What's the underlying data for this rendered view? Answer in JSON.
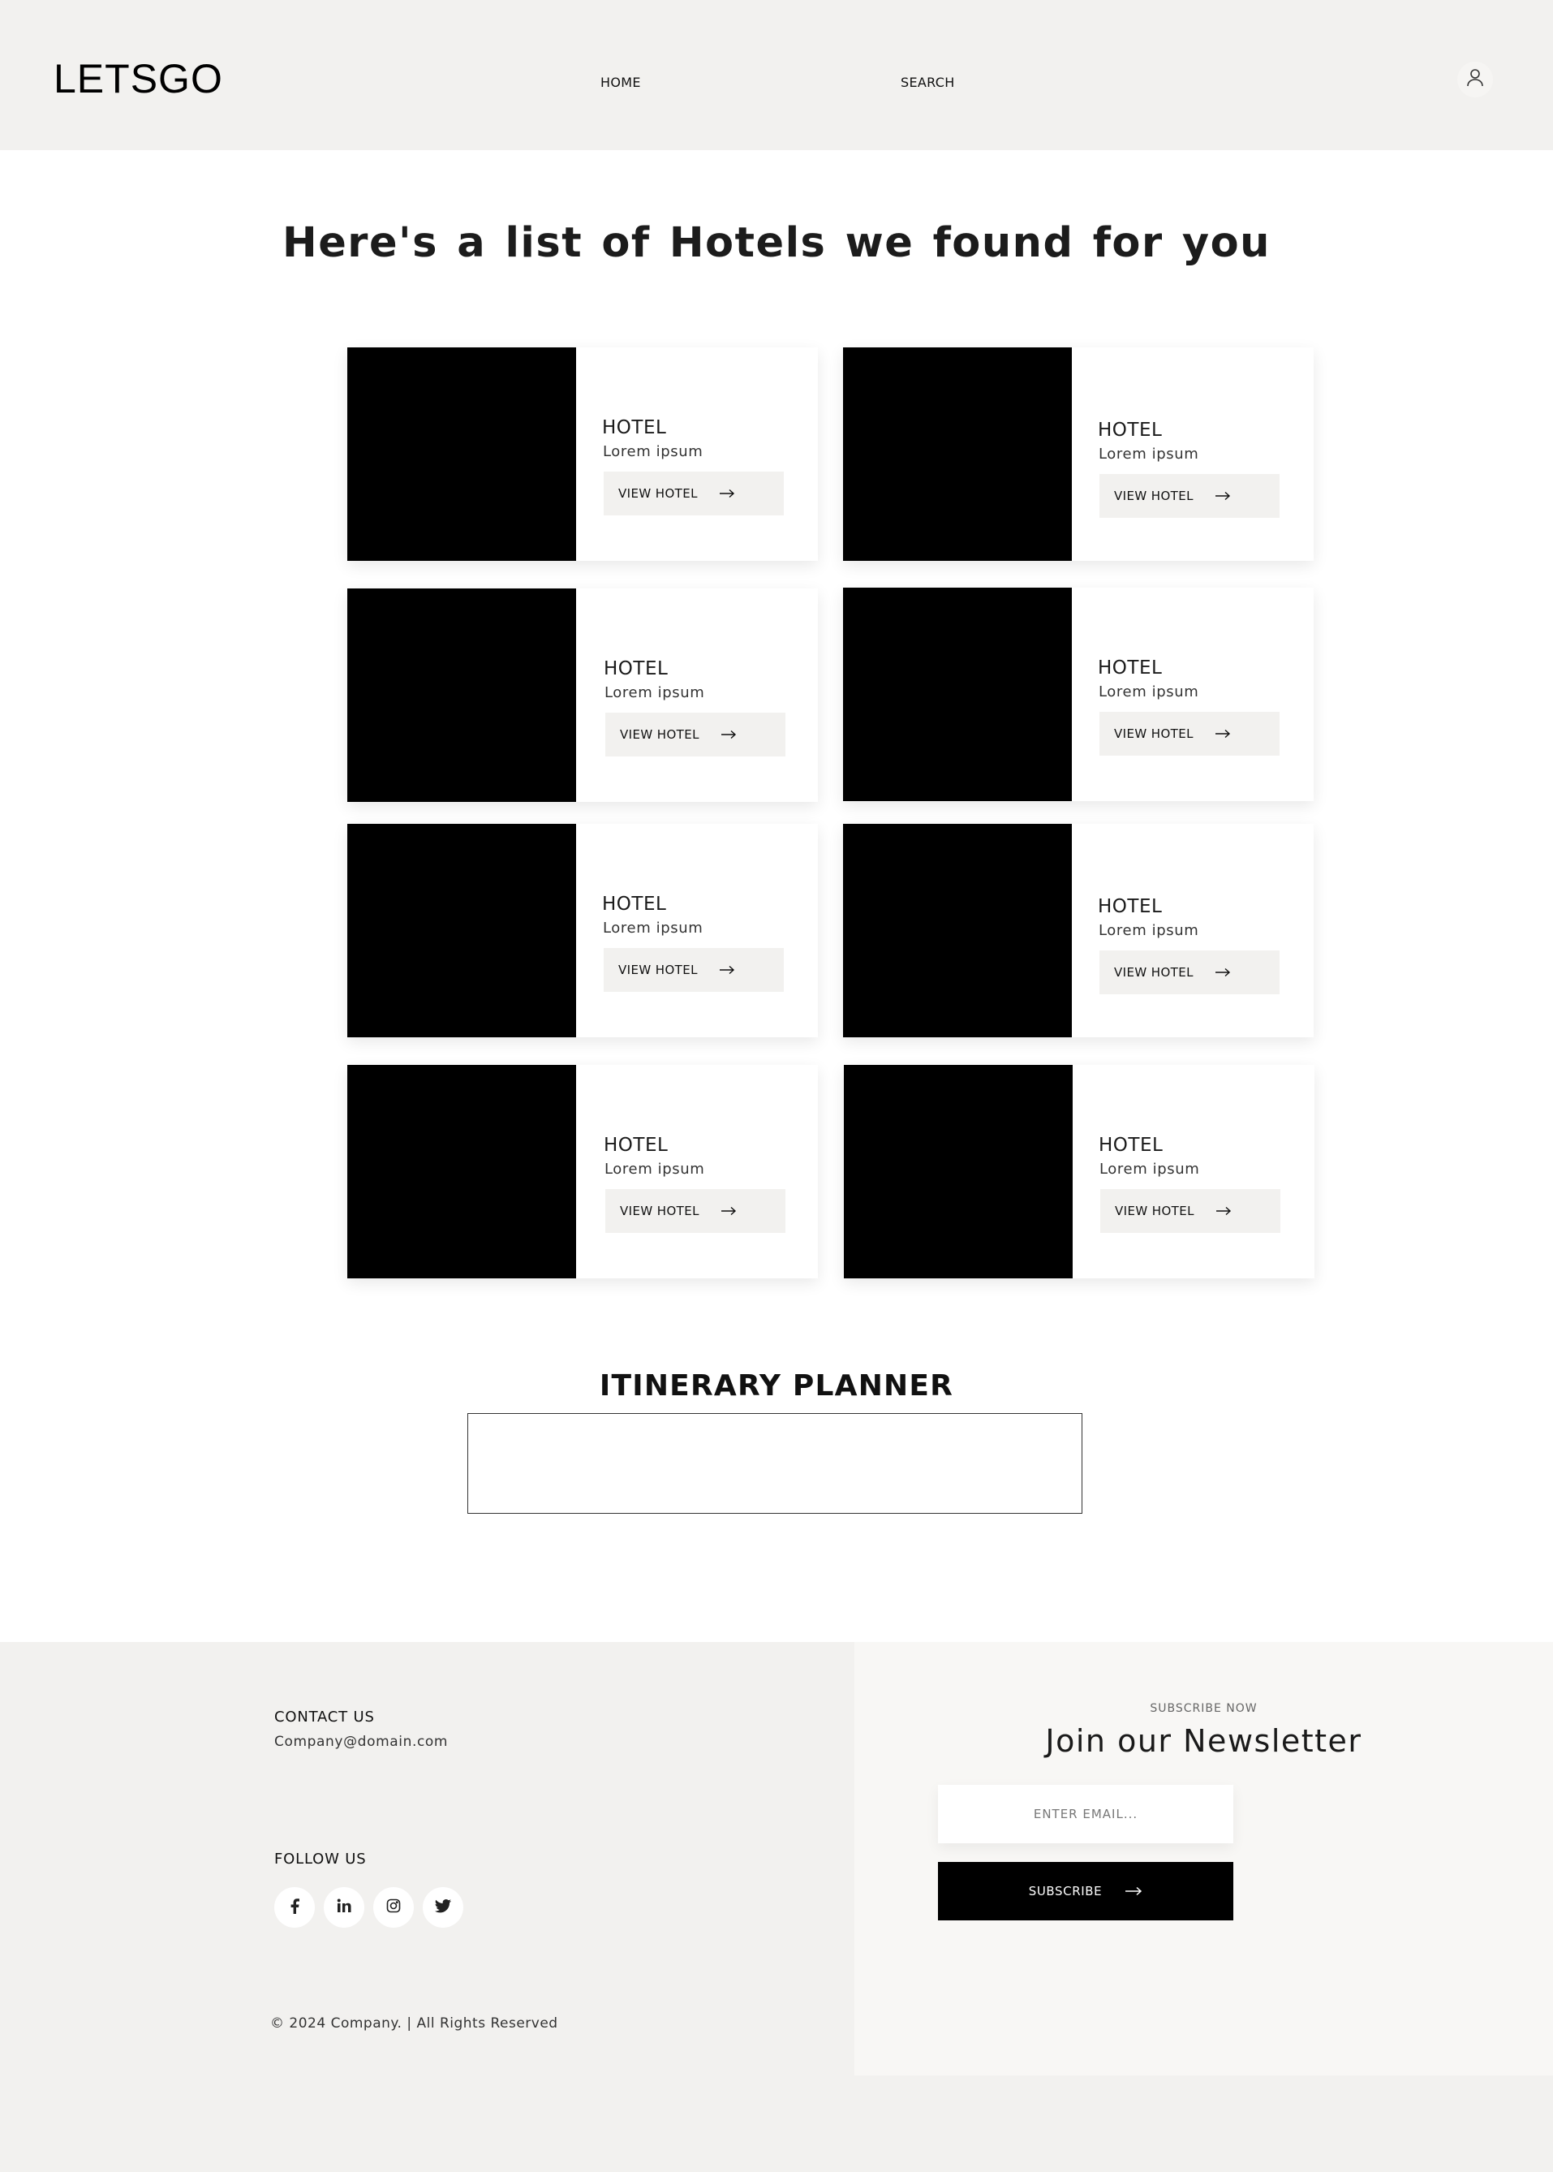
{
  "header": {
    "logo": "LETSGO",
    "nav": [
      {
        "label": "HOME"
      },
      {
        "label": "SEARCH"
      }
    ],
    "account_icon": "user-icon"
  },
  "main": {
    "headline": "Here's a list of  Hotels we found for you",
    "hotels": [
      {
        "title": "HOTEL",
        "subtitle": "Lorem ipsum",
        "button": "VIEW HOTEL"
      },
      {
        "title": "HOTEL",
        "subtitle": "Lorem ipsum",
        "button": "VIEW HOTEL"
      },
      {
        "title": "HOTEL",
        "subtitle": "Lorem ipsum",
        "button": "VIEW HOTEL"
      },
      {
        "title": "HOTEL",
        "subtitle": "Lorem ipsum",
        "button": "VIEW HOTEL"
      },
      {
        "title": "HOTEL",
        "subtitle": "Lorem ipsum",
        "button": "VIEW HOTEL"
      },
      {
        "title": "HOTEL",
        "subtitle": "Lorem ipsum",
        "button": "VIEW HOTEL"
      },
      {
        "title": "HOTEL",
        "subtitle": "Lorem ipsum",
        "button": "VIEW HOTEL"
      },
      {
        "title": "HOTEL",
        "subtitle": "Lorem ipsum",
        "button": "VIEW HOTEL"
      }
    ],
    "planner_title": "ITINERARY PLANNER"
  },
  "footer": {
    "contact_label": "CONTACT US",
    "contact_email": "Company@domain.com",
    "follow_label": "FOLLOW US",
    "socials": [
      "facebook-icon",
      "linkedin-icon",
      "instagram-icon",
      "twitter-icon"
    ],
    "copyright": "© 2024 Company. | All Rights Reserved",
    "newsletter": {
      "kicker": "SUBSCRIBE NOW",
      "title": "Join our Newsletter",
      "email_placeholder": "ENTER EMAIL...",
      "button": "SUBSCRIBE"
    }
  },
  "colors": {
    "header_bg": "#f2f1ef",
    "button_bg": "#f2f1ef",
    "image_placeholder": "#000000",
    "subscribe_bg": "#000000"
  }
}
